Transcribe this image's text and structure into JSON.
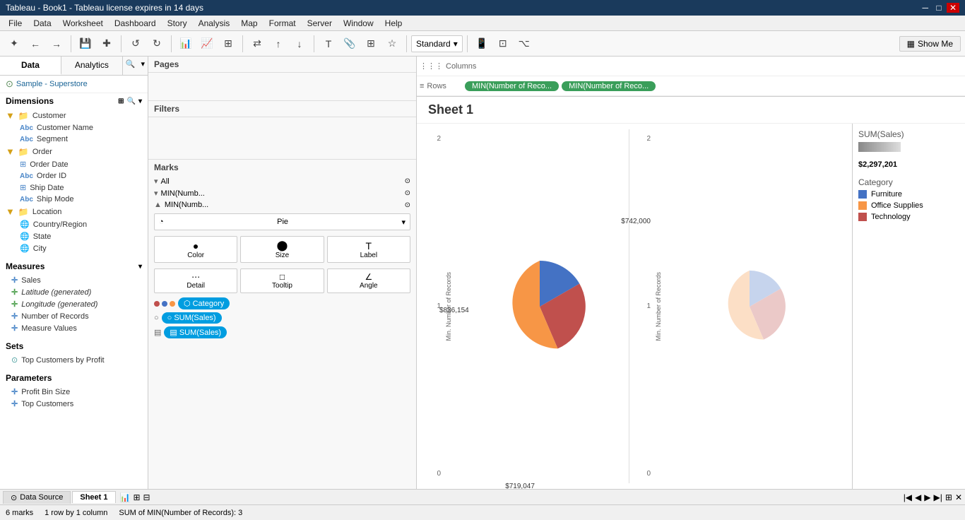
{
  "titlebar": {
    "title": "Tableau - Book1 - Tableau license expires in 14 days",
    "controls": [
      "─",
      "□",
      "✕"
    ]
  },
  "menubar": {
    "items": [
      "File",
      "Data",
      "Worksheet",
      "Dashboard",
      "Story",
      "Analysis",
      "Map",
      "Format",
      "Server",
      "Window",
      "Help"
    ]
  },
  "toolbar": {
    "show_me": "Show Me",
    "standard_label": "Standard",
    "buttons": [
      "✦",
      "←",
      "→",
      "💾",
      "➕",
      "⟳",
      "✕"
    ]
  },
  "left_panel": {
    "tabs": [
      "Data",
      "Analytics"
    ],
    "active_tab": "Data",
    "data_source": "Sample - Superstore",
    "sections": {
      "dimensions": {
        "label": "Dimensions",
        "groups": [
          {
            "name": "Customer",
            "type": "folder",
            "children": [
              {
                "name": "Customer Name",
                "type": "abc"
              },
              {
                "name": "Segment",
                "type": "abc"
              }
            ]
          },
          {
            "name": "Order",
            "type": "folder",
            "children": [
              {
                "name": "Order Date",
                "type": "cal"
              },
              {
                "name": "Order ID",
                "type": "abc"
              },
              {
                "name": "Ship Date",
                "type": "cal"
              },
              {
                "name": "Ship Mode",
                "type": "abc"
              }
            ]
          },
          {
            "name": "Location",
            "type": "folder",
            "children": [
              {
                "name": "Country/Region",
                "type": "globe"
              },
              {
                "name": "State",
                "type": "globe"
              },
              {
                "name": "City",
                "type": "globe"
              }
            ]
          }
        ]
      },
      "measures": {
        "label": "Measures",
        "items": [
          {
            "name": "Sales",
            "type": "plus"
          },
          {
            "name": "Latitude (generated)",
            "type": "plus-m"
          },
          {
            "name": "Longitude (generated)",
            "type": "plus-m"
          },
          {
            "name": "Number of Records",
            "type": "plus"
          },
          {
            "name": "Measure Values",
            "type": "plus"
          }
        ]
      },
      "sets": {
        "label": "Sets",
        "items": [
          {
            "name": "Top Customers by Profit",
            "type": "set"
          }
        ]
      },
      "parameters": {
        "label": "Parameters",
        "items": [
          {
            "name": "Profit Bin Size",
            "type": "plus"
          },
          {
            "name": "Top Customers",
            "type": "plus"
          }
        ]
      }
    }
  },
  "middle_panel": {
    "pages_label": "Pages",
    "filters_label": "Filters",
    "marks_label": "Marks",
    "marks_groups": [
      {
        "name": "All",
        "type": "all"
      },
      {
        "name": "MIN(Numb...",
        "type": "min"
      },
      {
        "name": "MIN(Numb...",
        "type": "min"
      }
    ],
    "marks_type": "Pie",
    "marks_buttons": [
      {
        "label": "Color",
        "icon": "●"
      },
      {
        "label": "Size",
        "icon": "⬤"
      },
      {
        "label": "Label",
        "icon": "T"
      },
      {
        "label": "Detail",
        "icon": "⋯"
      },
      {
        "label": "Tooltip",
        "icon": "💬"
      },
      {
        "label": "Angle",
        "icon": "∠"
      }
    ],
    "pills": [
      {
        "icon": "⬡",
        "label": "Category"
      },
      {
        "icon": "○",
        "label": "SUM(Sales)"
      },
      {
        "icon": "▤",
        "label": "SUM(Sales)"
      }
    ]
  },
  "canvas": {
    "columns_label": "Columns",
    "rows_label": "Rows",
    "rows_pills": [
      "MIN(Number of Reco...",
      "MIN(Number of Reco..."
    ],
    "sheet_title": "Sheet 1",
    "pie_data": [
      {
        "label": "Furniture",
        "value": 836154,
        "display": "$836,154",
        "color": "#4472c4",
        "angle": 120
      },
      {
        "label": "Technology",
        "value": 742000,
        "display": "$742,000",
        "color": "#c0504d",
        "angle": 105
      },
      {
        "label": "Office Supplies",
        "value": 719047,
        "display": "$719,047",
        "color": "#f79646",
        "angle": 135
      }
    ],
    "axis_ticks": [
      "0",
      "1",
      "2"
    ],
    "y_axis_label": "Min. Number of Records"
  },
  "legend": {
    "sum_label": "SUM(Sales)",
    "sum_value": "$2,297,201",
    "category_label": "Category",
    "items": [
      {
        "label": "Furniture",
        "color": "#4472c4"
      },
      {
        "label": "Office Supplies",
        "color": "#f79646"
      },
      {
        "label": "Technology",
        "color": "#c0504d"
      }
    ]
  },
  "bottom_tabs": {
    "data_source": "Data Source",
    "sheet1": "Sheet 1"
  },
  "statusbar": {
    "marks": "6 marks",
    "rows": "1 row by 1 column",
    "sum": "SUM of MIN(Number of Records): 3"
  }
}
